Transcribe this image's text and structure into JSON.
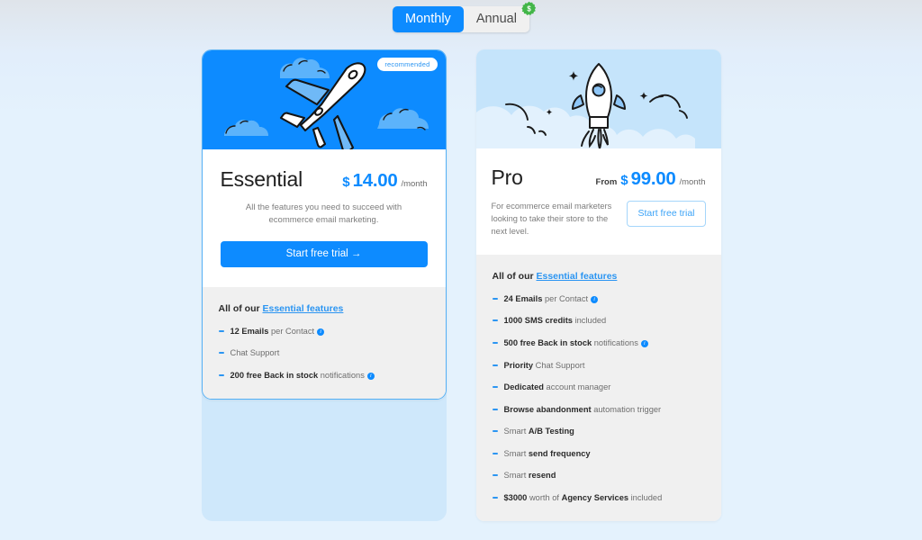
{
  "billing_toggle": {
    "options": [
      {
        "label": "Monthly",
        "active": true
      },
      {
        "label": "Annual",
        "active": false
      }
    ],
    "badge_icon": "discount-coin-icon",
    "active_color": "#0d8bff"
  },
  "plans": [
    {
      "id": "essential",
      "name": "Essential",
      "badge": "recommended",
      "hero_illustration": "airplane-icon",
      "price_prefix": "",
      "currency": "$",
      "amount": "14.00",
      "period": "/month",
      "description": "All the features you need to succeed with ecommerce email marketing.",
      "cta_label": "Start free trial  →",
      "cta_style": "solid",
      "features_heading_prefix": "All of our ",
      "features_heading_link": "Essential features",
      "features": [
        {
          "bold": "12 Emails",
          "rest": " per Contact",
          "info": true
        },
        {
          "bold": "",
          "rest": "Chat Support",
          "info": false
        },
        {
          "bold": "200 free Back in stock",
          "rest": " notifications",
          "info": true
        }
      ]
    },
    {
      "id": "pro",
      "name": "Pro",
      "badge": "",
      "hero_illustration": "rocket-icon",
      "price_prefix": "From",
      "currency": "$",
      "amount": "99.00",
      "period": "/month",
      "description": "For ecommerce email marketers looking to take their store to the next level.",
      "cta_label": "Start free trial",
      "cta_style": "outline",
      "features_heading_prefix": "All of our ",
      "features_heading_link": "Essential features",
      "features": [
        {
          "bold": "24 Emails",
          "rest": " per Contact",
          "info": true
        },
        {
          "bold": "1000 SMS credits",
          "rest": " included",
          "info": false
        },
        {
          "bold": "500 free Back in stock",
          "rest": " notifications",
          "info": true
        },
        {
          "bold": "Priority",
          "rest": " Chat Support",
          "info": false
        },
        {
          "bold": "Dedicated",
          "rest": " account manager",
          "info": false
        },
        {
          "bold": "Browse abandonment",
          "rest": " automation trigger",
          "info": false
        },
        {
          "pre": "Smart ",
          "bold": "A/B Testing",
          "rest": "",
          "info": false
        },
        {
          "pre": "Smart ",
          "bold": "send frequency",
          "rest": "",
          "info": false
        },
        {
          "pre": "Smart ",
          "bold": "resend",
          "rest": "",
          "info": false
        },
        {
          "bold": "$3000",
          "rest": " worth of ",
          "bold2": "Agency Services",
          "rest2": " included",
          "info": false
        }
      ]
    }
  ],
  "colors": {
    "accent": "#0d8bff",
    "link": "#2b95f2",
    "hero_pro_bg": "#c5e4fb",
    "features_bg": "#f0f0f0",
    "page_bg": "#e4f2fd"
  }
}
